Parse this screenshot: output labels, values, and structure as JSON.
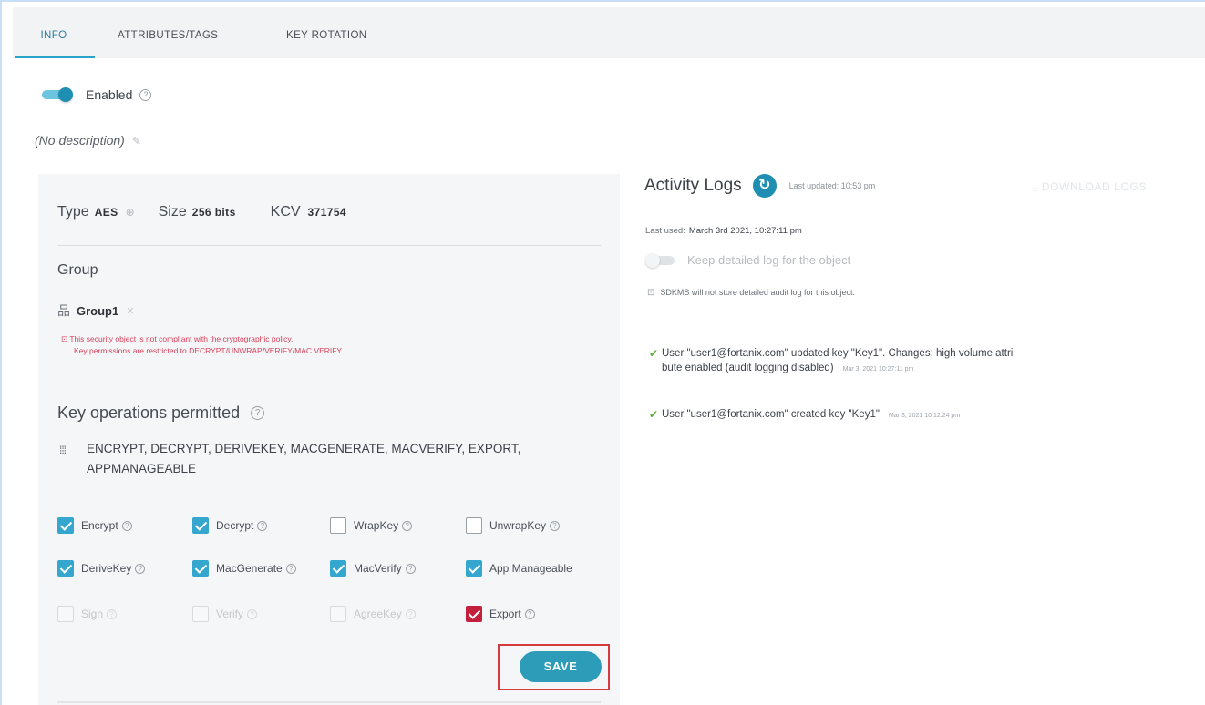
{
  "tabs": [
    {
      "label": "INFO"
    },
    {
      "label": "ATTRIBUTES/TAGS"
    },
    {
      "label": "KEY ROTATION"
    }
  ],
  "enabled": {
    "label": "Enabled",
    "on": true,
    "help": "?"
  },
  "description": "(No description)",
  "key_info": {
    "type_label": "Type",
    "type_value": "AES",
    "size_label": "Size",
    "size_value": "256 bits",
    "kcv_label": "KCV",
    "kcv_value": "371754"
  },
  "group": {
    "heading": "Group",
    "name": "Group1",
    "warning_line1": "This security object is not compliant with the cryptographic policy.",
    "warning_line2": "Key permissions are restricted to DECRYPT/UNWRAP/VERIFY/MAC VERIFY."
  },
  "key_operations": {
    "heading": "Key operations permitted",
    "summary": "ENCRYPT, DECRYPT, DERIVEKEY, MACGENERATE, MACVERIFY, EXPORT, APPMANAGEABLE",
    "checkboxes": [
      {
        "label": "Encrypt",
        "checked": true
      },
      {
        "label": "Decrypt",
        "checked": true
      },
      {
        "label": "WrapKey",
        "checked": false
      },
      {
        "label": "UnwrapKey",
        "checked": false
      },
      {
        "label": "DeriveKey",
        "checked": true
      },
      {
        "label": "MacGenerate",
        "checked": true
      },
      {
        "label": "MacVerify",
        "checked": true
      },
      {
        "label": "App Manageable",
        "checked": true
      },
      {
        "label": "Sign",
        "checked": false,
        "disabled": true
      },
      {
        "label": "Verify",
        "checked": false,
        "disabled": true
      },
      {
        "label": "AgreeKey",
        "checked": false,
        "disabled": true
      },
      {
        "label": "Export",
        "checked": true
      }
    ],
    "save_label": "SAVE"
  },
  "activity_logs": {
    "title": "Activity Logs",
    "last_updated": "Last updated: 10:53 pm",
    "download_label": "DOWNLOAD LOGS",
    "last_used_label": "Last used:",
    "last_used_value": "March 3rd 2021, 10:27:11 pm",
    "detailed_log_label": "Keep detailed log for the object",
    "notice": "SDKMS will not store detailed audit log for this object.",
    "entries": [
      {
        "line1": "User \"user1@fortanix.com\" updated key \"Key1\". Changes: high volume attri",
        "line2": "bute enabled (audit logging disabled)",
        "time": "Mar 3, 2021 10:27:11 pm"
      },
      {
        "line1": "User \"user1@fortanix.com\" created key \"Key1\"",
        "time": "Mar 3, 2021 10:12:24 pm"
      }
    ]
  },
  "colors": {
    "accent": "#1e8fb3",
    "checkbox": "#35a7cf",
    "danger": "#c2203c",
    "warning_text": "#d9415a"
  }
}
